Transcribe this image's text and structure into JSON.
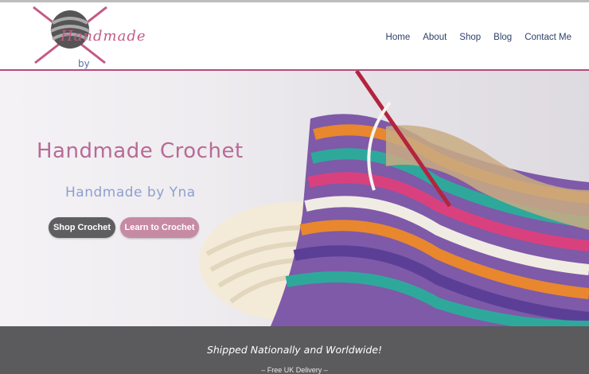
{
  "brand": {
    "logo_main": "Handmade",
    "logo_sub": "by YNA"
  },
  "nav": {
    "items": [
      {
        "label": "Home"
      },
      {
        "label": "About"
      },
      {
        "label": "Shop"
      },
      {
        "label": "Blog"
      },
      {
        "label": "Contact Me"
      }
    ]
  },
  "hero": {
    "title": "Handmade Crochet",
    "subtitle": "Handmade by Yna",
    "shop_button": "Shop Crochet",
    "learn_button": "Learn to Crochet"
  },
  "banner": {
    "title": "Shipped Nationally and Worldwide!",
    "subtitle": "– Free UK Delivery –"
  },
  "colors": {
    "accent_pink": "#b64a7d",
    "nav_text": "#2e3f6b",
    "button_dark": "#5e5d60",
    "button_pink": "#c78aa4",
    "banner_bg": "#5b5a5d"
  }
}
